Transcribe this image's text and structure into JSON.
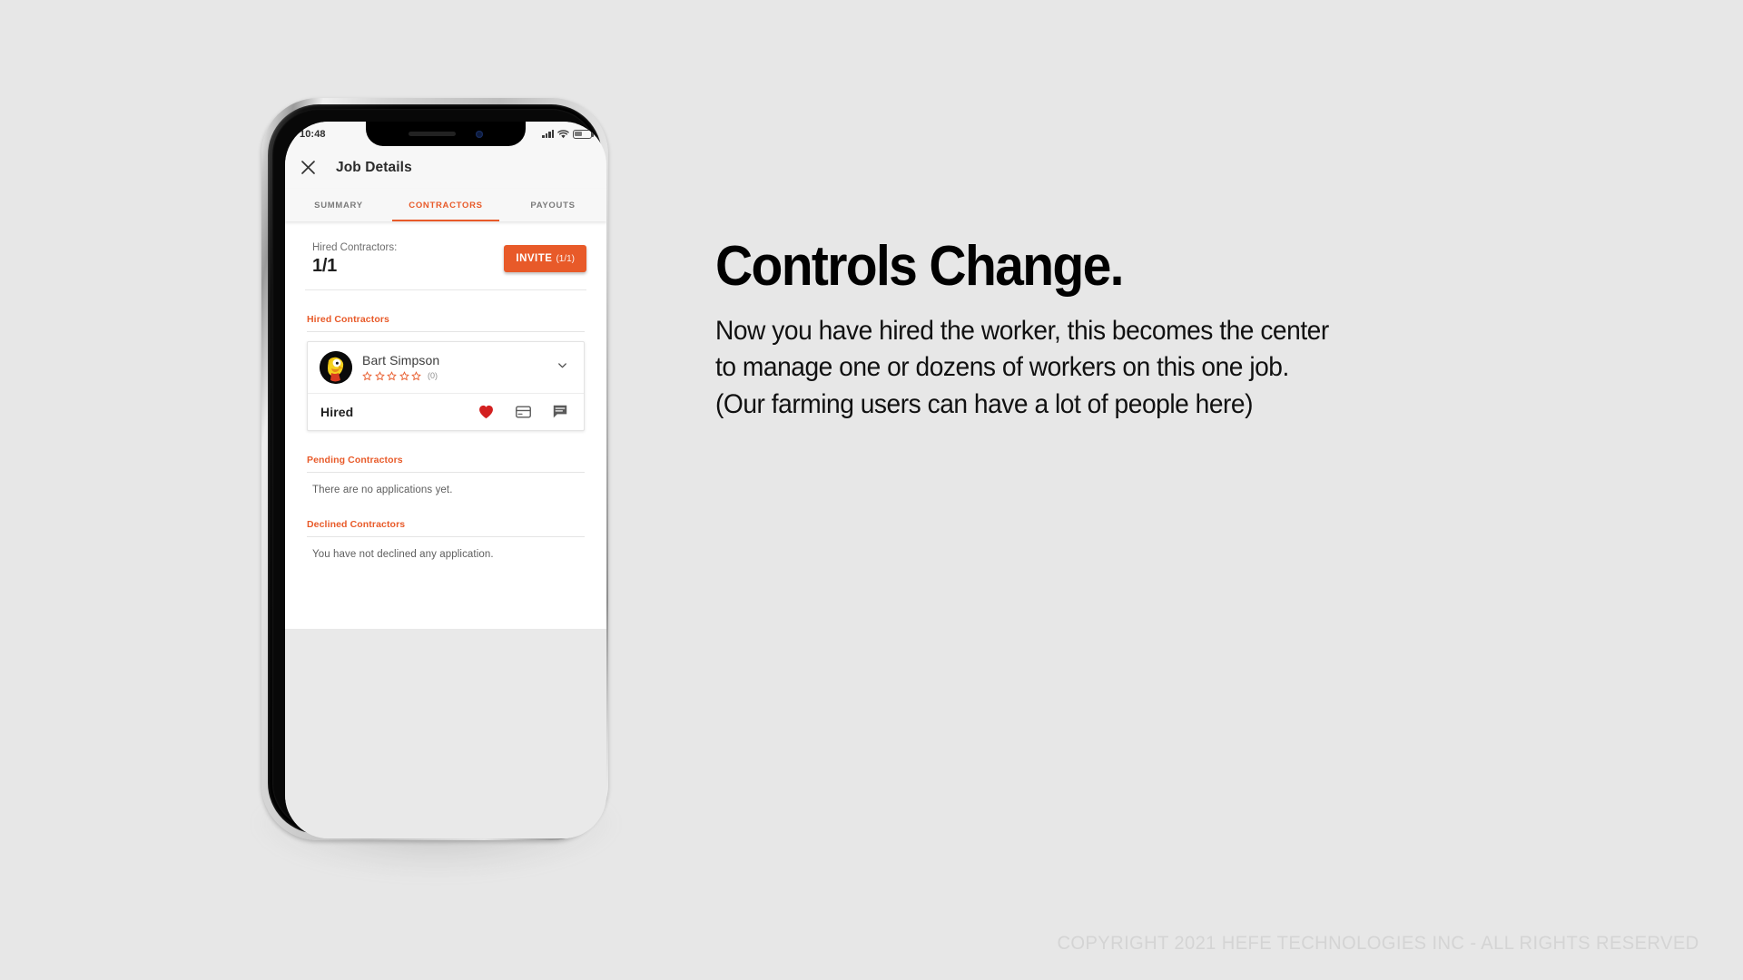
{
  "slide": {
    "headline": "Controls Change.",
    "body_lines": [
      "Now you have hired the worker, this becomes the center",
      "to manage one or dozens of workers on this one job.",
      "(Our farming users can have a lot of people here)"
    ],
    "copyright": "COPYRIGHT 2021 HEFE TECHNOLOGIES INC - ALL RIGHTS RESERVED"
  },
  "colors": {
    "accent_orange": "#e85a29",
    "heart_red": "#d32020",
    "page_background": "#e7e7e7",
    "icon_gray": "#5a5a5a"
  },
  "phone": {
    "status_bar": {
      "time": "10:48",
      "signal_icon": "signal-bars-icon",
      "wifi_icon": "wifi-icon",
      "battery_icon": "battery-icon"
    },
    "app_bar": {
      "close_icon": "close-icon",
      "title": "Job Details"
    },
    "tabs": [
      {
        "label": "SUMMARY",
        "active": false
      },
      {
        "label": "CONTRACTORS",
        "active": true
      },
      {
        "label": "PAYOUTS",
        "active": false
      }
    ],
    "counter": {
      "label": "Hired Contractors:",
      "value": "1/1",
      "invite_label": "INVITE",
      "invite_count": "(1/1)"
    },
    "sections": {
      "hired": {
        "heading": "Hired Contractors",
        "contractor": {
          "name": "Bart Simpson",
          "avatar_icon": "avatar",
          "rating_stars": 5,
          "rating_filled": 0,
          "rating_count": "(0)",
          "expand_icon": "chevron-down-icon",
          "status": "Hired",
          "actions": [
            {
              "icon": "heart-icon",
              "label": "favorite"
            },
            {
              "icon": "credit-card-icon",
              "label": "payment"
            },
            {
              "icon": "chat-icon",
              "label": "message"
            }
          ]
        }
      },
      "pending": {
        "heading": "Pending Contractors",
        "empty_message": "There are no applications yet."
      },
      "declined": {
        "heading": "Declined Contractors",
        "empty_message": "You have not declined any application."
      }
    }
  }
}
